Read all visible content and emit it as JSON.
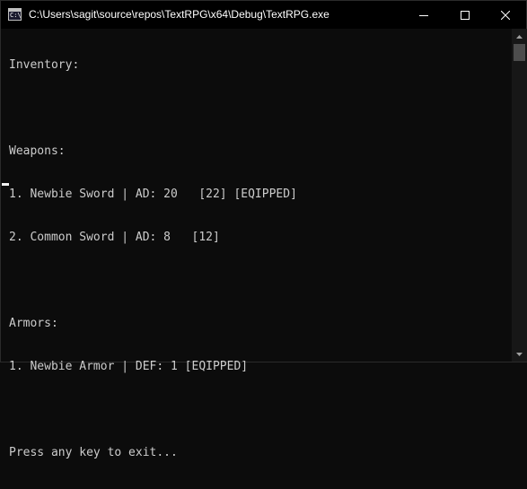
{
  "window": {
    "title": "C:\\Users\\sagit\\source\\repos\\TextRPG\\x64\\Debug\\TextRPG.exe",
    "icon_label": "C:\\",
    "icon": "console-icon",
    "controls": {
      "minimize_icon": "minimize-icon",
      "maximize_icon": "maximize-icon",
      "close_icon": "close-icon"
    }
  },
  "console": {
    "lines": [
      "Inventory:",
      "",
      "Weapons:",
      "1. Newbie Sword | AD: 20   [22] [EQIPPED]",
      "2. Common Sword | AD: 8   [12]",
      "",
      "Armors:",
      "1. Newbie Armor | DEF: 1 [EQIPPED]",
      "",
      "Press any key to exit..."
    ],
    "text_color": "#cccccc",
    "background_color": "#0c0c0c"
  },
  "scrollbar": {
    "up_icon": "scroll-up-arrow-icon",
    "down_icon": "scroll-down-arrow-icon"
  }
}
